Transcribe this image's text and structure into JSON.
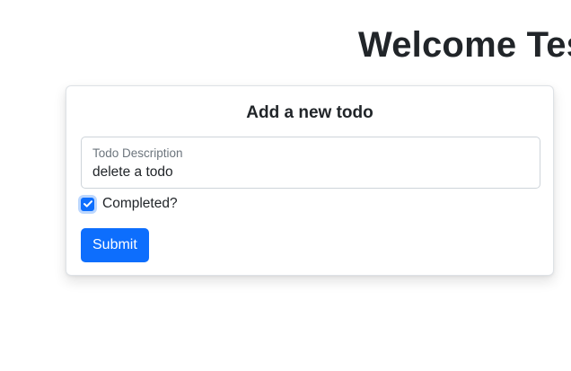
{
  "header": {
    "welcome_text": "Welcome Tes"
  },
  "todo_form": {
    "title": "Add a new todo",
    "description_label": "Todo Description",
    "description_value": "delete a todo",
    "completed_label": "Completed?",
    "completed_checked": true,
    "submit_label": "Submit"
  },
  "theme": {
    "primary": "#0d6efd",
    "text": "#212529",
    "muted": "#6c757d",
    "border": "#ced4da"
  },
  "icons": {
    "checkbox": "checkmark-icon"
  }
}
